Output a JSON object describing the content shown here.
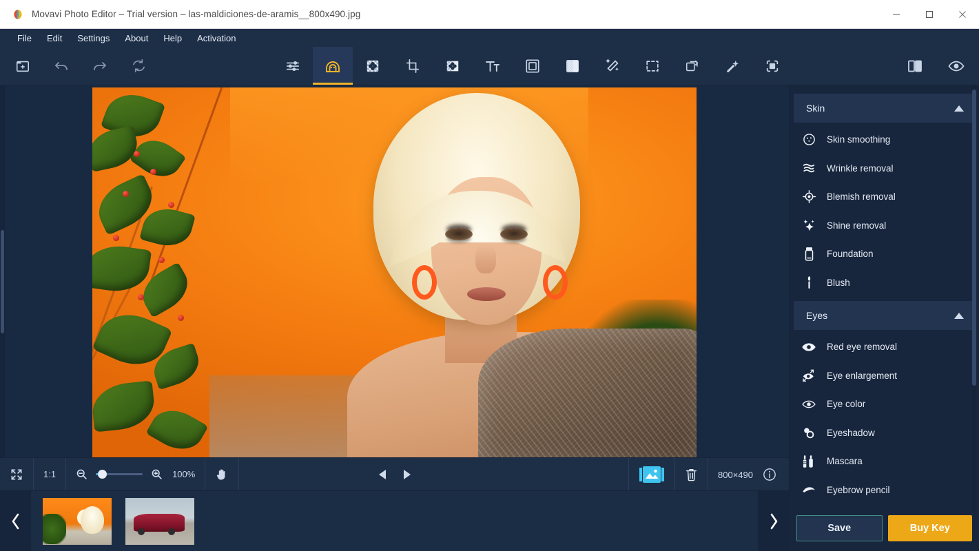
{
  "window": {
    "title": "Movavi Photo Editor – Trial version – las-maldiciones-de-aramis__800x490.jpg",
    "minimize_label": "Minimize",
    "maximize_label": "Maximize",
    "close_label": "Close"
  },
  "menubar": {
    "items": [
      {
        "label": "File"
      },
      {
        "label": "Edit"
      },
      {
        "label": "Settings"
      },
      {
        "label": "About"
      },
      {
        "label": "Help"
      },
      {
        "label": "Activation"
      }
    ]
  },
  "toolbar": {
    "left": [
      {
        "name": "add-image-icon",
        "title": "Add image"
      },
      {
        "name": "undo-icon",
        "title": "Undo"
      },
      {
        "name": "redo-icon",
        "title": "Redo"
      },
      {
        "name": "reset-icon",
        "title": "Reset"
      }
    ],
    "tabs": [
      {
        "name": "adjust-icon",
        "title": "Adjust",
        "active": false
      },
      {
        "name": "retouching-icon",
        "title": "Retouching",
        "active": true
      },
      {
        "name": "background-removal-icon",
        "title": "Background removal",
        "active": false
      },
      {
        "name": "crop-icon",
        "title": "Crop",
        "active": false
      },
      {
        "name": "object-removal-icon",
        "title": "Object removal",
        "active": false
      },
      {
        "name": "text-icon",
        "title": "Text",
        "active": false
      },
      {
        "name": "frames-icon",
        "title": "Frames",
        "active": false
      },
      {
        "name": "effects-icon",
        "title": "Effects",
        "active": false
      },
      {
        "name": "magic-enhance-icon",
        "title": "Magic enhance",
        "active": false
      },
      {
        "name": "selection-icon",
        "title": "Selection",
        "active": false
      },
      {
        "name": "insert-picture-icon",
        "title": "Insert picture",
        "active": false
      },
      {
        "name": "magic-wand-icon",
        "title": "Magic wand",
        "active": false
      },
      {
        "name": "change-background-icon",
        "title": "Change background",
        "active": false
      }
    ],
    "right": [
      {
        "name": "compare-icon",
        "title": "Compare"
      },
      {
        "name": "preview-eye-icon",
        "title": "Show original"
      }
    ]
  },
  "statusbar": {
    "fit_label": "Fit to screen",
    "actual_size_label": "1:1",
    "zoom_out_label": "Zoom out",
    "zoom_in_label": "Zoom in",
    "zoom_value": "100%",
    "hand_tool_label": "Pan",
    "prev_label": "Previous image",
    "next_label": "Next image",
    "filmstrip_toggle_label": "Show image list",
    "delete_label": "Delete",
    "dimensions": "800×490",
    "info_label": "Image info"
  },
  "filmstrip": {
    "prev_arrow_label": "Scroll left",
    "next_arrow_label": "Scroll right",
    "items": [
      {
        "name": "thumbnail-woman",
        "selected": true
      },
      {
        "name": "thumbnail-car",
        "selected": false
      }
    ]
  },
  "right_panel": {
    "sections": [
      {
        "id": "skin",
        "title": "Skin",
        "expanded": true,
        "caret": "▲",
        "tools": [
          {
            "icon": "skin-smoothing-icon",
            "label": "Skin smoothing"
          },
          {
            "icon": "wrinkle-removal-icon",
            "label": "Wrinkle removal"
          },
          {
            "icon": "blemish-removal-icon",
            "label": "Blemish removal"
          },
          {
            "icon": "shine-removal-icon",
            "label": "Shine removal"
          },
          {
            "icon": "foundation-icon",
            "label": "Foundation"
          },
          {
            "icon": "blush-icon",
            "label": "Blush"
          }
        ]
      },
      {
        "id": "eyes",
        "title": "Eyes",
        "expanded": true,
        "caret": "▲",
        "tools": [
          {
            "icon": "red-eye-removal-icon",
            "label": "Red eye removal"
          },
          {
            "icon": "eye-enlargement-icon",
            "label": "Eye enlargement"
          },
          {
            "icon": "eye-color-icon",
            "label": "Eye color"
          },
          {
            "icon": "eyeshadow-icon",
            "label": "Eyeshadow"
          },
          {
            "icon": "mascara-icon",
            "label": "Mascara"
          },
          {
            "icon": "eyebrow-pencil-icon",
            "label": "Eyebrow pencil"
          }
        ]
      }
    ],
    "save_label": "Save",
    "buy_key_label": "Buy Key"
  },
  "colors": {
    "accent_gold": "#f0b429",
    "buy_button": "#eda818",
    "save_border": "#3e8f82",
    "panel_bg": "#18263d",
    "chrome_bg": "#1d2e47",
    "selection_cyan": "#3fb8d4"
  }
}
